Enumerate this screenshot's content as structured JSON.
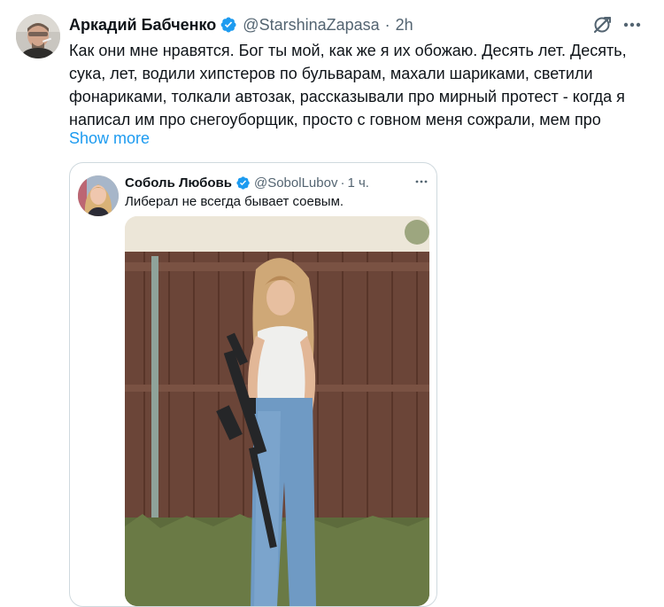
{
  "tweet": {
    "author_name": "Аркадий Бабченко",
    "handle": "@StarshinaZapasa",
    "time": "2h",
    "separator": "·",
    "text": "Как они мне нравятся. Бог ты мой, как же я их обожаю. Десять лет. Десять, сука, лет, водили хипстеров по бульварам, махали шариками, светили фонариками, толкали автозак, рассказывали про мирный протест - когда я написал им про снегоуборщик, просто с говном меня сожрали, мем про",
    "show_more": "Show more",
    "icons": {
      "verified": "verified-badge-icon",
      "grok": "grok-icon",
      "more": "more-options-icon"
    },
    "colors": {
      "accent": "#1d9bf0",
      "secondary_text": "#536471",
      "text": "#0f1419",
      "border": "#cfd9de"
    }
  },
  "quote": {
    "author_name": "Соболь Любовь",
    "handle": "@SobolLubov",
    "separator": "·",
    "time": "1 ч.",
    "text": "Либерал не всегда бывает соевым.",
    "media_description_icon": "photo-woman-with-rifle"
  }
}
